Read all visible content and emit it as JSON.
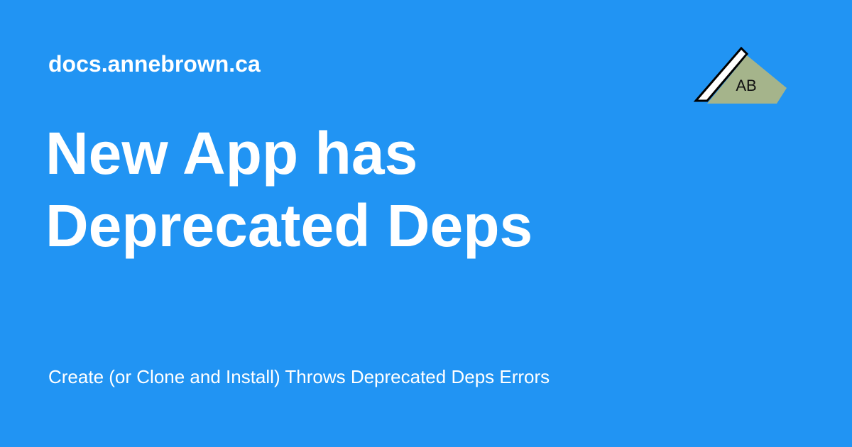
{
  "card": {
    "site": "docs.annebrown.ca",
    "title_line1": "New App has",
    "title_line2": "Deprecated Deps",
    "subtitle": "Create (or Clone and Install) Throws Deprecated Deps Errors",
    "logo_text": "AB"
  },
  "colors": {
    "background": "#2194f3",
    "text": "#ffffff",
    "logo_fill": "#a5b48b",
    "logo_outline": "#000000"
  },
  "icons": {
    "logo": "mountain-monogram-logo"
  }
}
